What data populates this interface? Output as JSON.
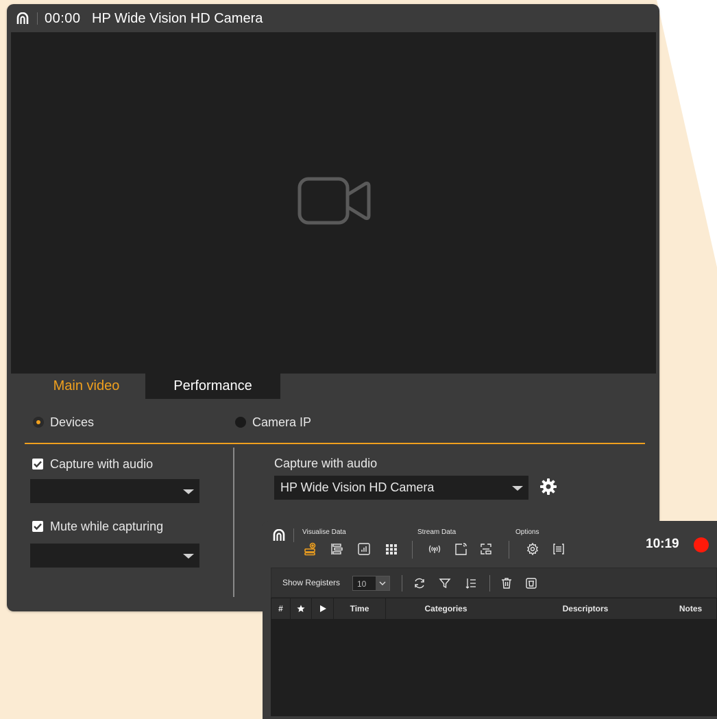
{
  "camera_window": {
    "time": "00:00",
    "title": "HP Wide Vision HD Camera",
    "tabs": [
      "Main video",
      "Performance"
    ],
    "source_options": [
      "Devices",
      "Camera IP"
    ],
    "capture_audio_label": "Capture with audio",
    "mute_label": "Mute while capturing",
    "right_capture_label": "Capture with audio",
    "camera_select_value": "HP Wide Vision HD Camera"
  },
  "data_window": {
    "groups": [
      "Visualise Data",
      "Stream Data",
      "Options"
    ],
    "clock": "10:19",
    "show_registers_label": "Show Registers",
    "registers_value": "10",
    "columns": [
      "#",
      "Time",
      "Categories",
      "Descriptors",
      "Notes"
    ]
  },
  "colors": {
    "accent": "#f0a01e",
    "record": "#ff1a0a",
    "background_shape": "#fbebd3",
    "panel": "#3b3b3b",
    "video": "#1f1f1f"
  },
  "icons": [
    "app-logo-icon",
    "video-camera-icon",
    "settings-gear-icon",
    "record-icon"
  ]
}
